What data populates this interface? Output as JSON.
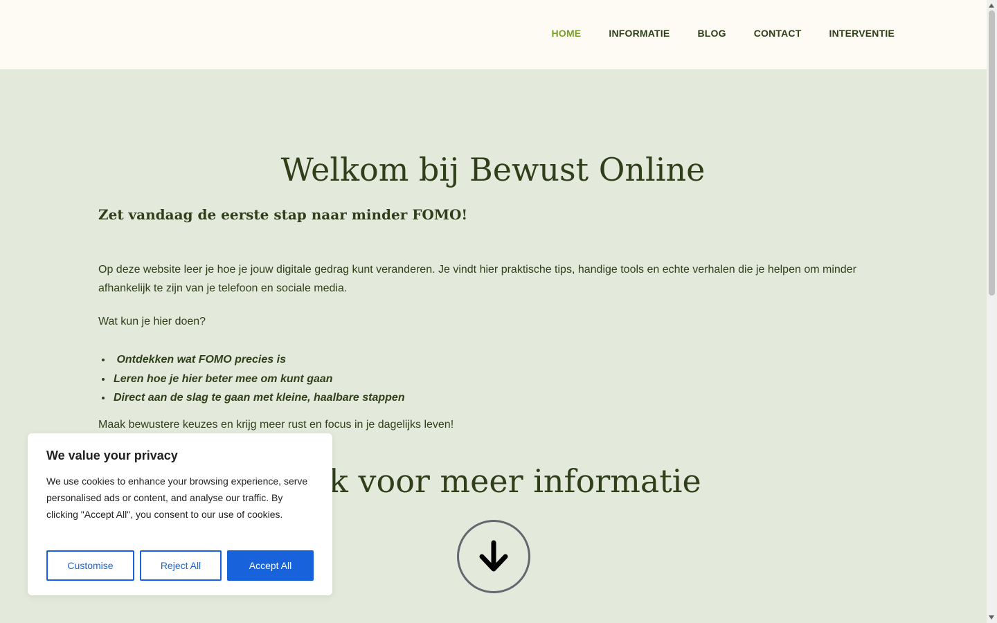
{
  "nav": {
    "items": [
      {
        "label": "HOME",
        "active": true
      },
      {
        "label": "INFORMATIE"
      },
      {
        "label": "BLOG"
      },
      {
        "label": "CONTACT"
      },
      {
        "label": "INTERVENTIE"
      }
    ]
  },
  "hero": {
    "title": "Welkom bij Bewust Online",
    "subtitle": "Zet vandaag de eerste stap naar minder FOMO!",
    "intro": "Op deze website leer je hoe je jouw digitale gedrag kunt veranderen. Je vindt hier praktische tips, handige tools en echte verhalen die je helpen om minder afhankelijk te zijn van je telefoon en sociale media.",
    "question": "Wat kun je hier doen?",
    "bullets": [
      " Ontdekken wat FOMO precies is",
      "Leren hoe je hier beter mee om kunt gaan",
      "Direct aan de slag te gaan met kleine, haalbare stappen"
    ],
    "closing": "Maak bewustere keuzes en krijg meer rust en focus in je dagelijks leven!",
    "more_info": "Klik voor meer informatie"
  },
  "cookie": {
    "title": "We value your privacy",
    "text": "We use cookies to enhance your browsing experience, serve personalised ads or content, and analyse our traffic. By clicking \"Accept All\", you consent to our use of cookies.",
    "customise_label": "Customise",
    "reject_label": "Reject All",
    "accept_label": "Accept All"
  },
  "colors": {
    "header_bg": "#fdfbf3",
    "page_bg": "#e3eadb",
    "text": "#2e3f1a",
    "nav_active": "#7aa02c",
    "cookie_accent": "#1863dc"
  },
  "icons": {
    "scroll_arrow": "arrow-down-icon"
  }
}
